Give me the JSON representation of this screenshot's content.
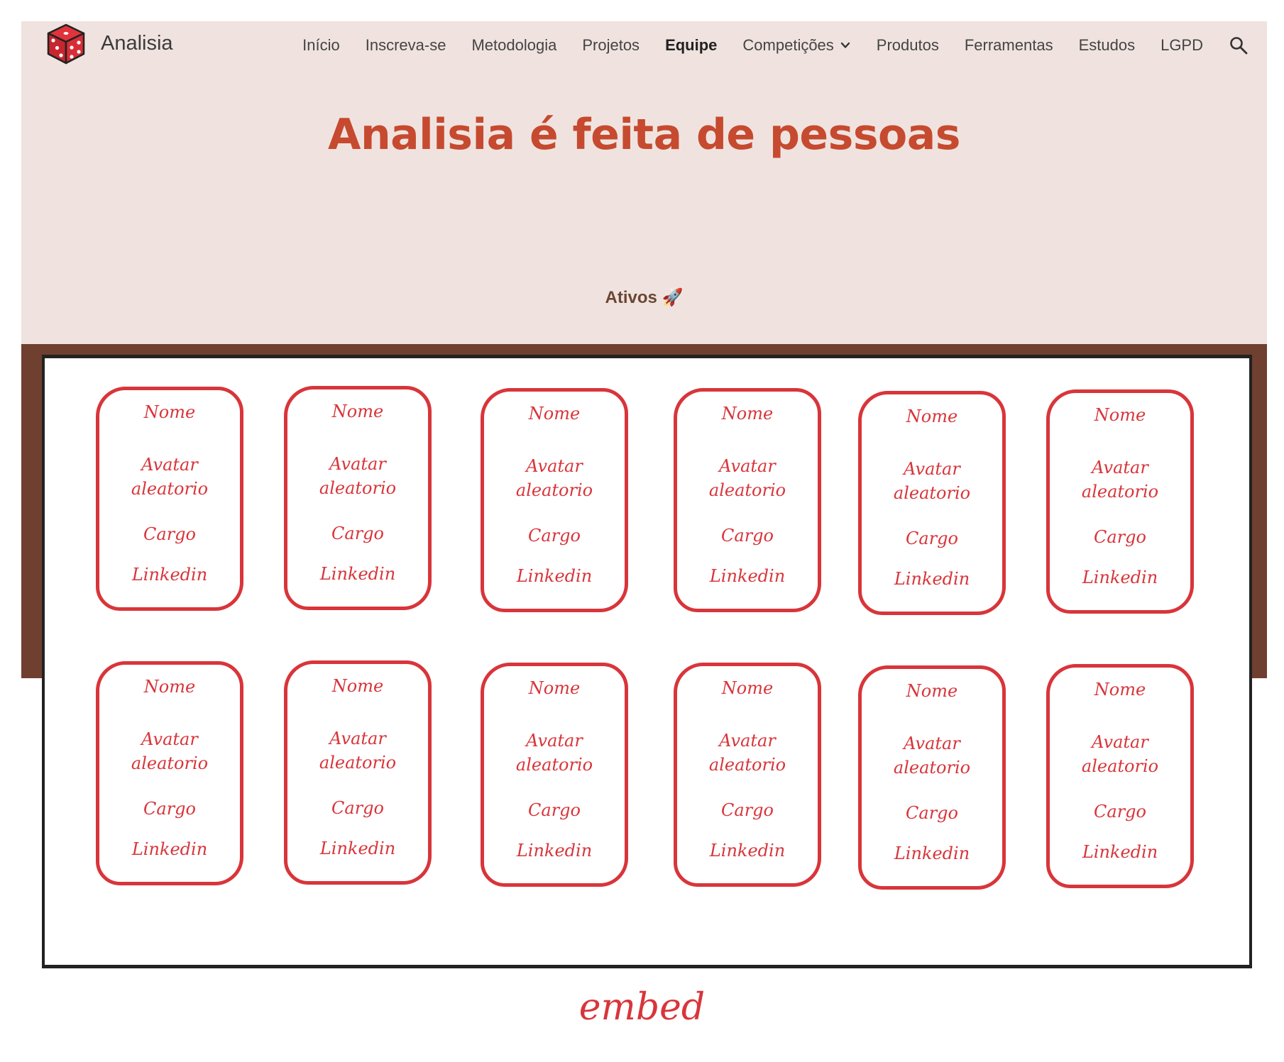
{
  "header": {
    "brand": "Analisia",
    "nav": [
      {
        "label": "Início",
        "active": false
      },
      {
        "label": "Inscreva-se",
        "active": false
      },
      {
        "label": "Metodologia",
        "active": false
      },
      {
        "label": "Projetos",
        "active": false
      },
      {
        "label": "Equipe",
        "active": true
      },
      {
        "label": "Competições",
        "active": false,
        "dropdown": true
      },
      {
        "label": "Produtos",
        "active": false
      },
      {
        "label": "Ferramentas",
        "active": false
      },
      {
        "label": "Estudos",
        "active": false
      },
      {
        "label": "LGPD",
        "active": false
      }
    ],
    "search_icon": "search-icon"
  },
  "hero": {
    "title": "Analisia é feita de pessoas",
    "section_label": "Ativos 🚀"
  },
  "cards": [
    {
      "name": "Nome",
      "avatar": "Avatar aleatorio",
      "cargo": "Cargo",
      "linkedin": "Linkedin"
    },
    {
      "name": "Nome",
      "avatar": "Avatar aleatorio",
      "cargo": "Cargo",
      "linkedin": "Linkedin"
    },
    {
      "name": "Nome",
      "avatar": "Avatar aleatorio",
      "cargo": "Cargo",
      "linkedin": "Linkedin"
    },
    {
      "name": "Nome",
      "avatar": "Avatar aleatorio",
      "cargo": "Cargo",
      "linkedin": "Linkedin"
    },
    {
      "name": "Nome",
      "avatar": "Avatar aleatorio",
      "cargo": "Cargo",
      "linkedin": "Linkedin"
    },
    {
      "name": "Nome",
      "avatar": "Avatar aleatorio",
      "cargo": "Cargo",
      "linkedin": "Linkedin"
    },
    {
      "name": "Nome",
      "avatar": "Avatar aleatorio",
      "cargo": "Cargo",
      "linkedin": "Linkedin"
    },
    {
      "name": "Nome",
      "avatar": "Avatar aleatorio",
      "cargo": "Cargo",
      "linkedin": "Linkedin"
    },
    {
      "name": "Nome",
      "avatar": "Avatar aleatorio",
      "cargo": "Cargo",
      "linkedin": "Linkedin"
    },
    {
      "name": "Nome",
      "avatar": "Avatar aleatorio",
      "cargo": "Cargo",
      "linkedin": "Linkedin"
    },
    {
      "name": "Nome",
      "avatar": "Avatar aleatorio",
      "cargo": "Cargo",
      "linkedin": "Linkedin"
    },
    {
      "name": "Nome",
      "avatar": "Avatar aleatorio",
      "cargo": "Cargo",
      "linkedin": "Linkedin"
    }
  ],
  "embed_caption": "embed",
  "colors": {
    "site_bg": "#f0e3df",
    "accent": "#c64a2f",
    "band": "#6f3f2f",
    "sketch_red": "#d8353a"
  }
}
